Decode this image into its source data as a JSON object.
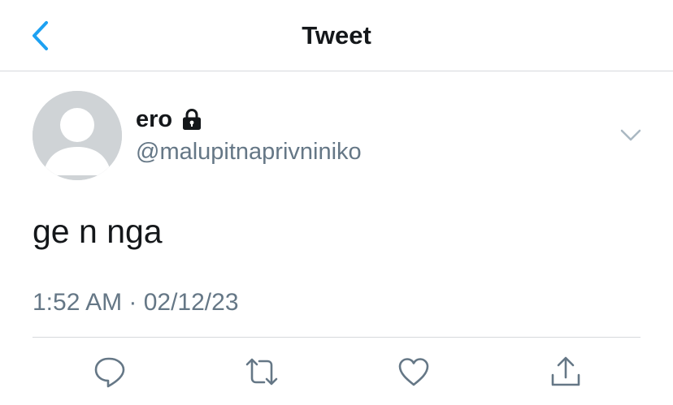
{
  "header": {
    "title": "Tweet",
    "back_icon": "chevron-left-icon",
    "accent_color": "#1da1f2"
  },
  "tweet": {
    "author": {
      "display_name": "ero",
      "username": "@malupitnaprivniniko",
      "protected_icon": "lock-icon",
      "avatar": "default-avatar"
    },
    "text": "ge n nga",
    "timestamp": "1:52 AM · 02/12/23",
    "menu_icon": "chevron-down-icon"
  },
  "actions": [
    {
      "name": "reply",
      "icon": "reply-icon"
    },
    {
      "name": "retweet",
      "icon": "retweet-icon"
    },
    {
      "name": "like",
      "icon": "heart-icon"
    },
    {
      "name": "share",
      "icon": "share-icon"
    }
  ],
  "colors": {
    "text_primary": "#14171a",
    "text_secondary": "#657786",
    "divider": "#d6d9dc",
    "avatar_bg": "#cfd3d6"
  }
}
